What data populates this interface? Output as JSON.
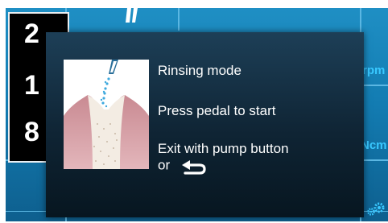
{
  "background": {
    "digits": [
      "2",
      "1",
      "8"
    ],
    "units": [
      "rpm",
      "Ncm"
    ],
    "icon_settings": "gear-icon"
  },
  "dialog": {
    "title": "Rinsing mode",
    "instruction": "Press pedal to start",
    "exit_line1": "Exit with pump button",
    "exit_line2": "or",
    "back_icon": "return-arrow-icon",
    "illustration": "rinsing-tooth-illustration"
  },
  "colors": {
    "screen_blue": "#137cb2",
    "dialog_dark": "#0f2434",
    "accent_cyan": "#39c8ff",
    "text_white": "#ffffff"
  }
}
